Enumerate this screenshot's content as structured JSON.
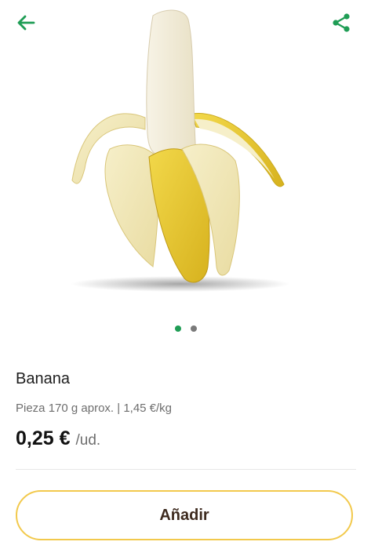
{
  "header": {
    "back_icon": "arrow-left-icon",
    "share_icon": "share-icon",
    "accent_color": "#1f9d55"
  },
  "gallery": {
    "image_subject": "peeled banana",
    "page_count": 2,
    "active_page": 1
  },
  "product": {
    "name": "Banana",
    "description": "Pieza 170 g aprox. | 1,45 €/kg",
    "price": "0,25 €",
    "unit": "/ud."
  },
  "actions": {
    "add_label": "Añadir",
    "add_border_color": "#f2c94c"
  }
}
